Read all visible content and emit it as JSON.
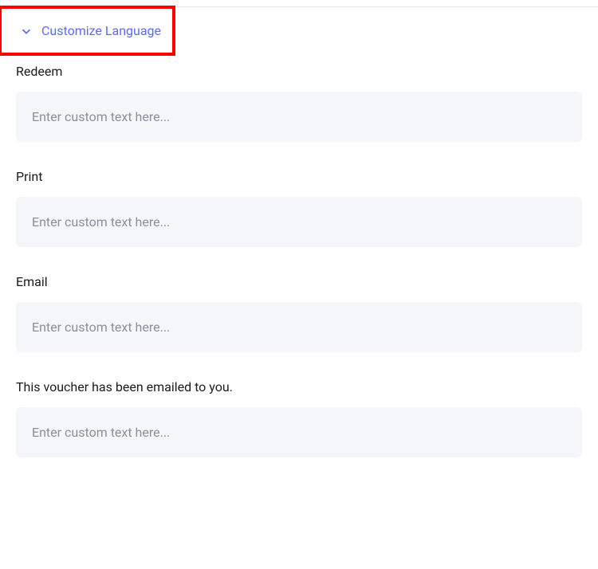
{
  "accordion": {
    "title": "Customize Language"
  },
  "fields": {
    "redeem": {
      "label": "Redeem",
      "placeholder": "Enter custom text here...",
      "value": ""
    },
    "print": {
      "label": "Print",
      "placeholder": "Enter custom text here...",
      "value": ""
    },
    "email": {
      "label": "Email",
      "placeholder": "Enter custom text here...",
      "value": ""
    },
    "emailed_confirmation": {
      "label": "This voucher has been emailed to you.",
      "placeholder": "Enter custom text here...",
      "value": ""
    }
  },
  "highlight": {
    "color": "#ff0000"
  }
}
